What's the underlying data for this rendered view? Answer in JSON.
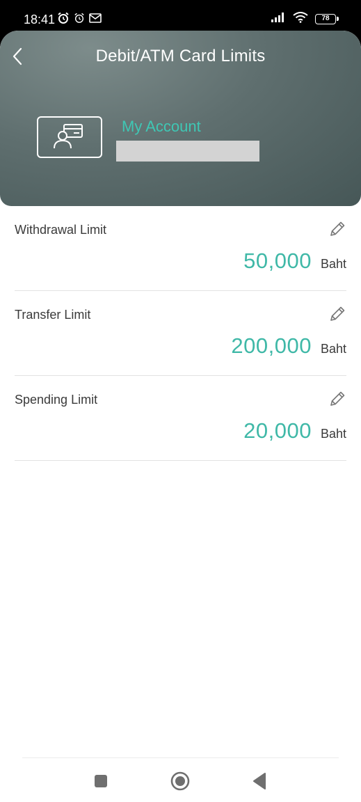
{
  "status_bar": {
    "time": "18:41",
    "battery": "78",
    "icons_left": [
      "alarm-clock-icon",
      "alarm-clock-icon",
      "mail-icon"
    ],
    "icons_right": [
      "signal-icon",
      "wifi-icon",
      "battery-icon"
    ]
  },
  "header": {
    "title": "Debit/ATM Card Limits",
    "account_name": "My Account",
    "accent_color": "#3fc7b4"
  },
  "limits": [
    {
      "label": "Withdrawal Limit",
      "amount": "50,000",
      "unit": "Baht"
    },
    {
      "label": "Transfer Limit",
      "amount": "200,000",
      "unit": "Baht"
    },
    {
      "label": "Spending Limit",
      "amount": "20,000",
      "unit": "Baht"
    }
  ],
  "nav": {
    "buttons": [
      "recents-square-icon",
      "home-circle-icon",
      "back-triangle-icon"
    ]
  }
}
